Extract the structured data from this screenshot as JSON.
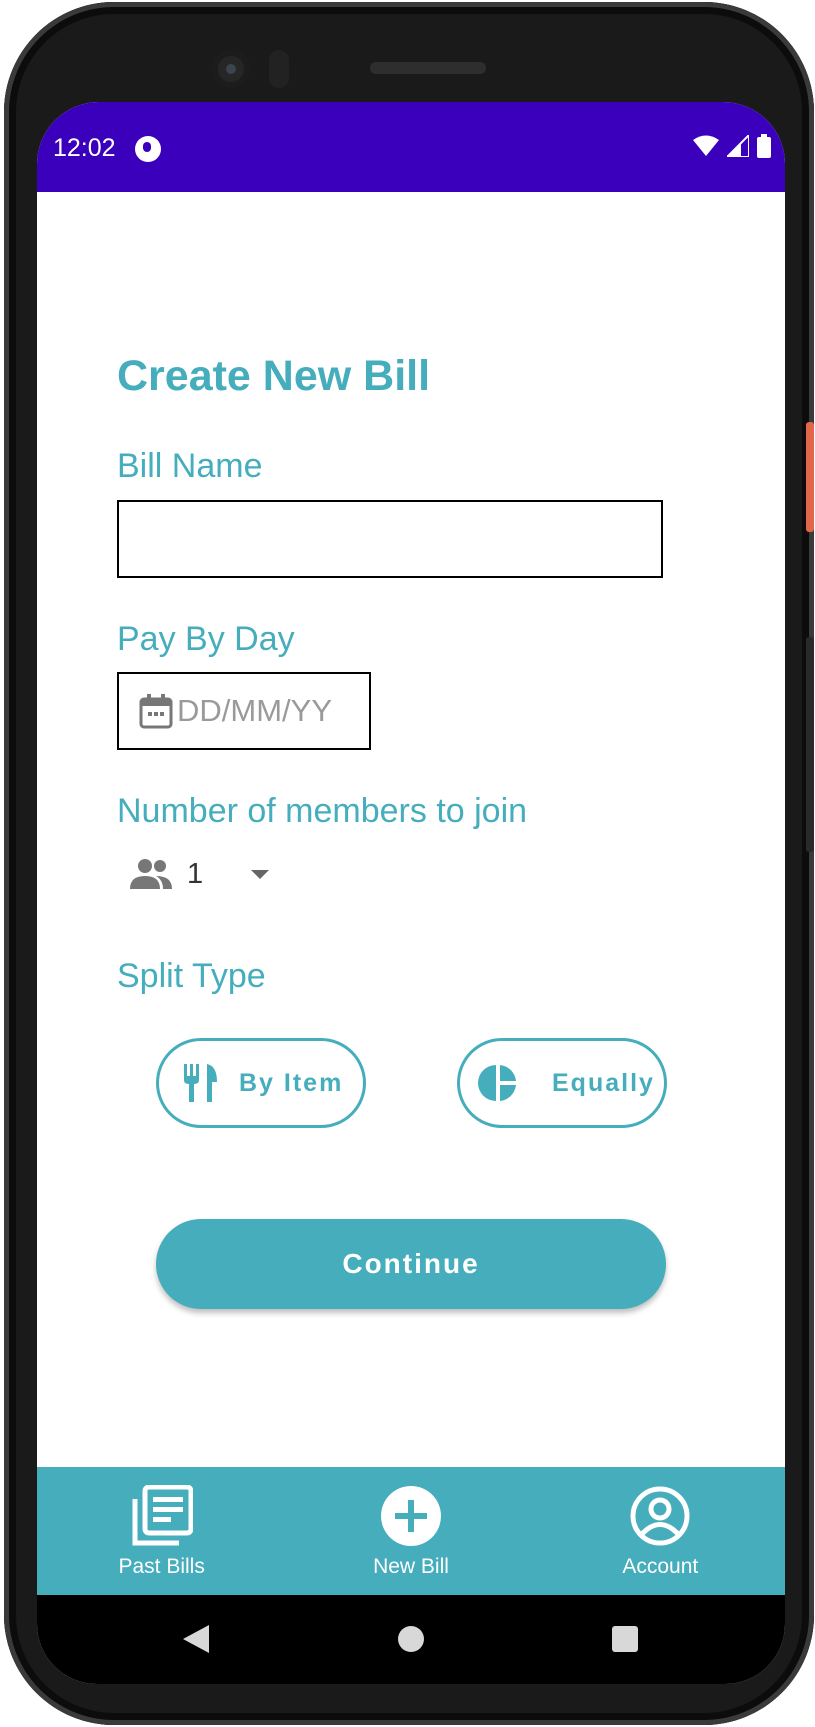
{
  "status_bar": {
    "time": "12:02",
    "background_color": "#3a00bc"
  },
  "form": {
    "title": "Create New Bill",
    "bill_name_label": "Bill Name",
    "bill_name_value": "",
    "pay_by_label": "Pay By Day",
    "date_placeholder": "DD/MM/YY",
    "members_label": "Number of members to join",
    "members_value": "1",
    "split_type_label": "Split Type",
    "split_options": [
      {
        "label": "By Item",
        "icon": "utensils-icon"
      },
      {
        "label": "Equally",
        "icon": "pie-chart-icon"
      }
    ],
    "continue_label": "Continue",
    "accent_color": "#45adbc"
  },
  "bottom_nav": {
    "items": [
      {
        "label": "Past Bills",
        "icon": "receipt-list-icon"
      },
      {
        "label": "New Bill",
        "icon": "add-circle-icon"
      },
      {
        "label": "Account",
        "icon": "account-circle-icon"
      }
    ]
  }
}
